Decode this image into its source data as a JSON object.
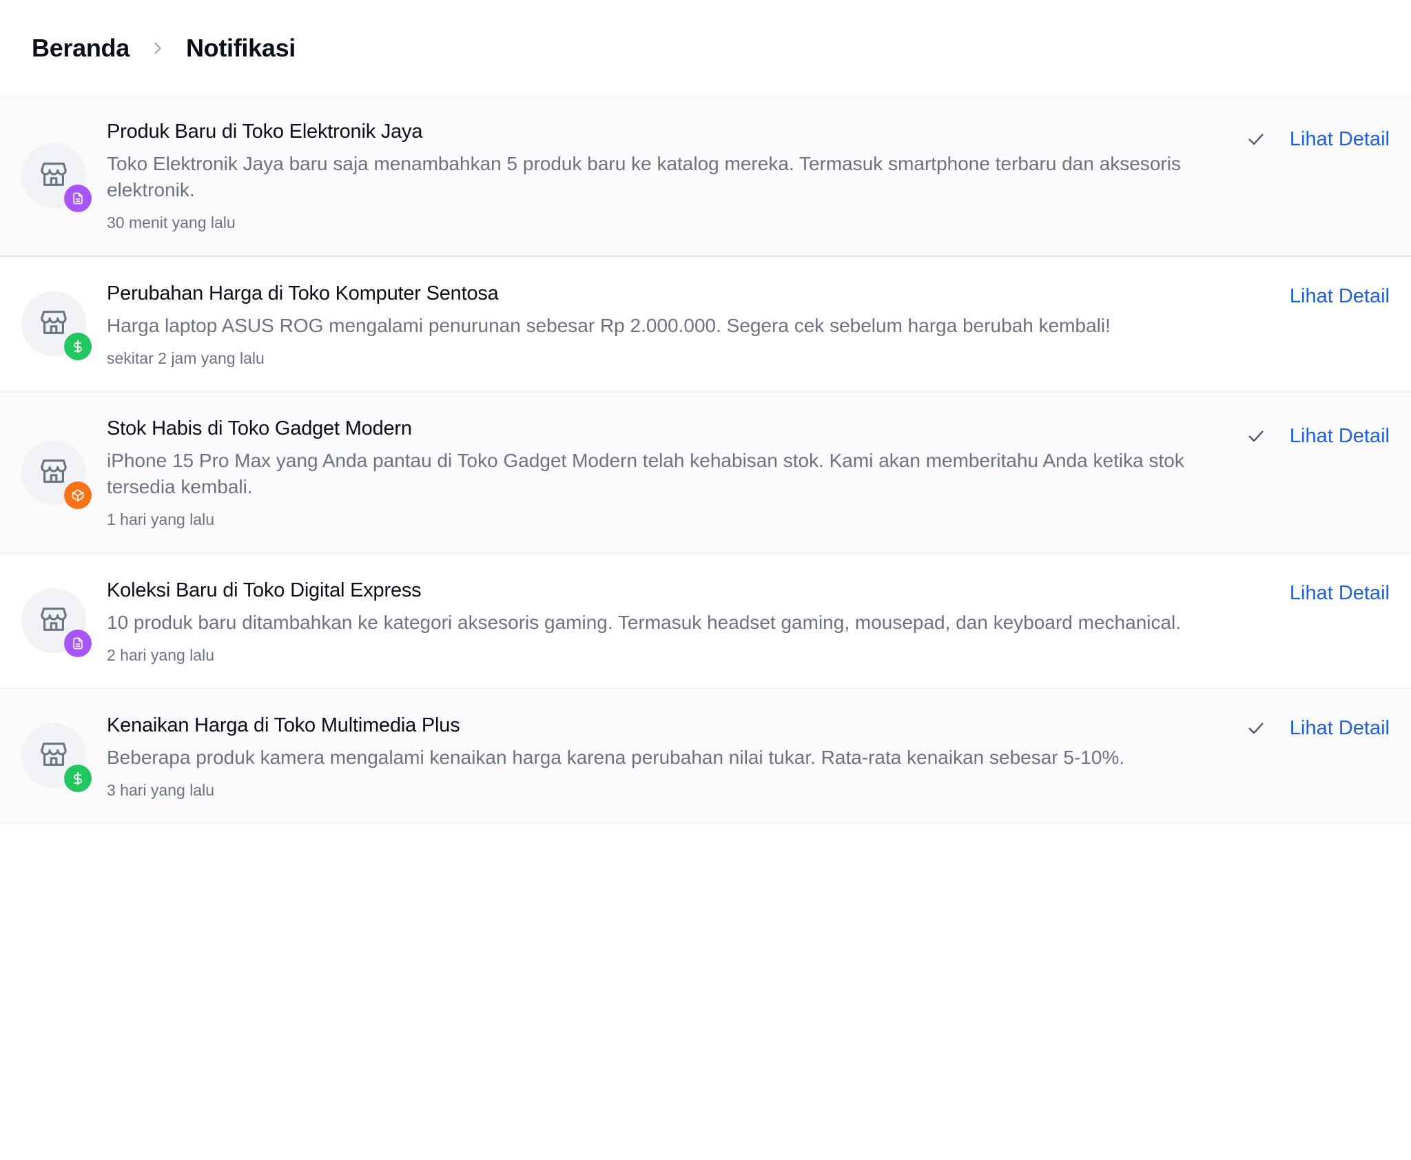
{
  "breadcrumb": {
    "home": "Beranda",
    "current": "Notifikasi"
  },
  "colors": {
    "link": "#1d5fe0",
    "badge_purple": "#a855f7",
    "badge_green": "#22c55e",
    "badge_orange": "#f97316"
  },
  "notifications": [
    {
      "title": "Produk Baru di Toko Elektronik Jaya",
      "message": "Toko Elektronik Jaya baru saja menambahkan 5 produk baru ke katalog mereka. Termasuk smartphone terbaru dan aksesoris elektronik.",
      "time": "30 menit yang lalu",
      "badge_icon": "document-icon",
      "badge_color": "purple",
      "show_mark_read": true,
      "action_label": "Lihat Detail"
    },
    {
      "title": "Perubahan Harga di Toko Komputer Sentosa",
      "message": "Harga laptop ASUS ROG mengalami penurunan sebesar Rp 2.000.000. Segera cek sebelum harga berubah kembali!",
      "time": "sekitar 2 jam yang lalu",
      "badge_icon": "dollar-icon",
      "badge_color": "green",
      "show_mark_read": false,
      "action_label": "Lihat Detail"
    },
    {
      "title": "Stok Habis di Toko Gadget Modern",
      "message": "iPhone 15 Pro Max yang Anda pantau di Toko Gadget Modern telah kehabisan stok. Kami akan memberitahu Anda ketika stok tersedia kembali.",
      "time": "1 hari yang lalu",
      "badge_icon": "package-icon",
      "badge_color": "orange",
      "show_mark_read": true,
      "action_label": "Lihat Detail"
    },
    {
      "title": "Koleksi Baru di Toko Digital Express",
      "message": "10 produk baru ditambahkan ke kategori aksesoris gaming. Termasuk headset gaming, mousepad, dan keyboard mechanical.",
      "time": "2 hari yang lalu",
      "badge_icon": "document-icon",
      "badge_color": "purple",
      "show_mark_read": false,
      "action_label": "Lihat Detail"
    },
    {
      "title": "Kenaikan Harga di Toko Multimedia Plus",
      "message": "Beberapa produk kamera mengalami kenaikan harga karena perubahan nilai tukar. Rata-rata kenaikan sebesar 5-10%.",
      "time": "3 hari yang lalu",
      "badge_icon": "dollar-icon",
      "badge_color": "green",
      "show_mark_read": true,
      "action_label": "Lihat Detail"
    }
  ]
}
